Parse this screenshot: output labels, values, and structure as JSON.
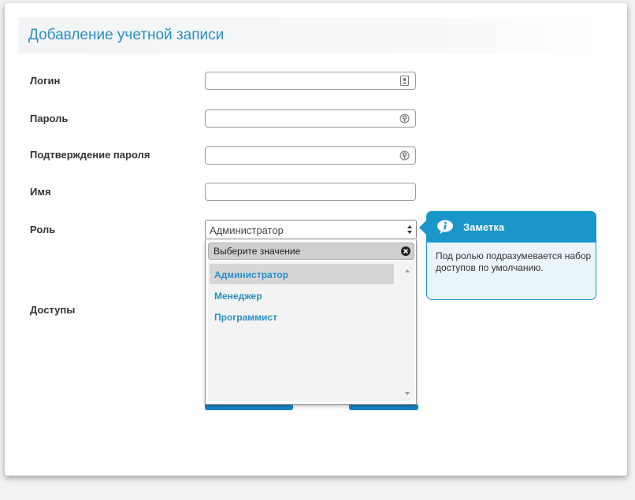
{
  "page": {
    "title": "Добавление учетной записи"
  },
  "form": {
    "login_label": "Логин",
    "login_value": "",
    "password_label": "Пароль",
    "password_value": "",
    "confirm_label": "Подтверждение пароля",
    "confirm_value": "",
    "name_label": "Имя",
    "name_value": "",
    "role_label": "Роль",
    "access_label": "Доступы"
  },
  "role_select": {
    "value": "Администратор",
    "dropdown_header": "Выберите значение",
    "options": [
      "Администратор",
      "Менеджер",
      "Программист"
    ],
    "selected_index": 0
  },
  "note": {
    "title": "Заметка",
    "text": "Под ролью подразумевается набор доступов по умолчанию."
  },
  "colors": {
    "accent": "#2a8fc8",
    "note_header": "#1a96cb",
    "note_body": "#eaf5fa"
  },
  "icons": {
    "login": "contact-card-icon",
    "password": "key-icon",
    "confirm": "key-icon",
    "note": "info-icon",
    "clear": "clear-icon"
  }
}
